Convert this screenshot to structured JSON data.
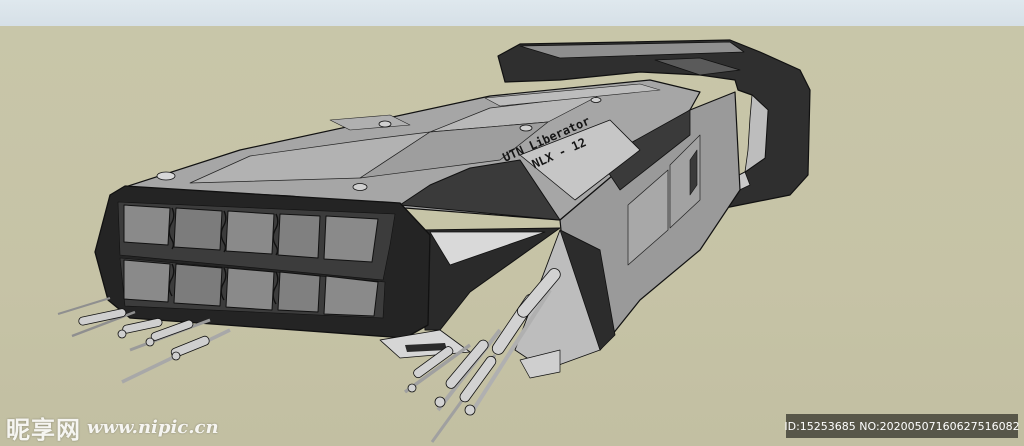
{
  "hull_marking": {
    "line1": "UTN Liberator",
    "line2": "NLX - 12"
  },
  "watermark": {
    "brand_cn": "昵享网",
    "brand_url": "www.nipic.cn",
    "id_text": "ID:15253685 NO:20200507160627516082"
  },
  "colors": {
    "sky": "#dbe4ea",
    "ground": "#c7c4a7",
    "hull_light": "#a5a5a5",
    "hull_dark": "#2b2b2b",
    "outline": "#111111"
  }
}
